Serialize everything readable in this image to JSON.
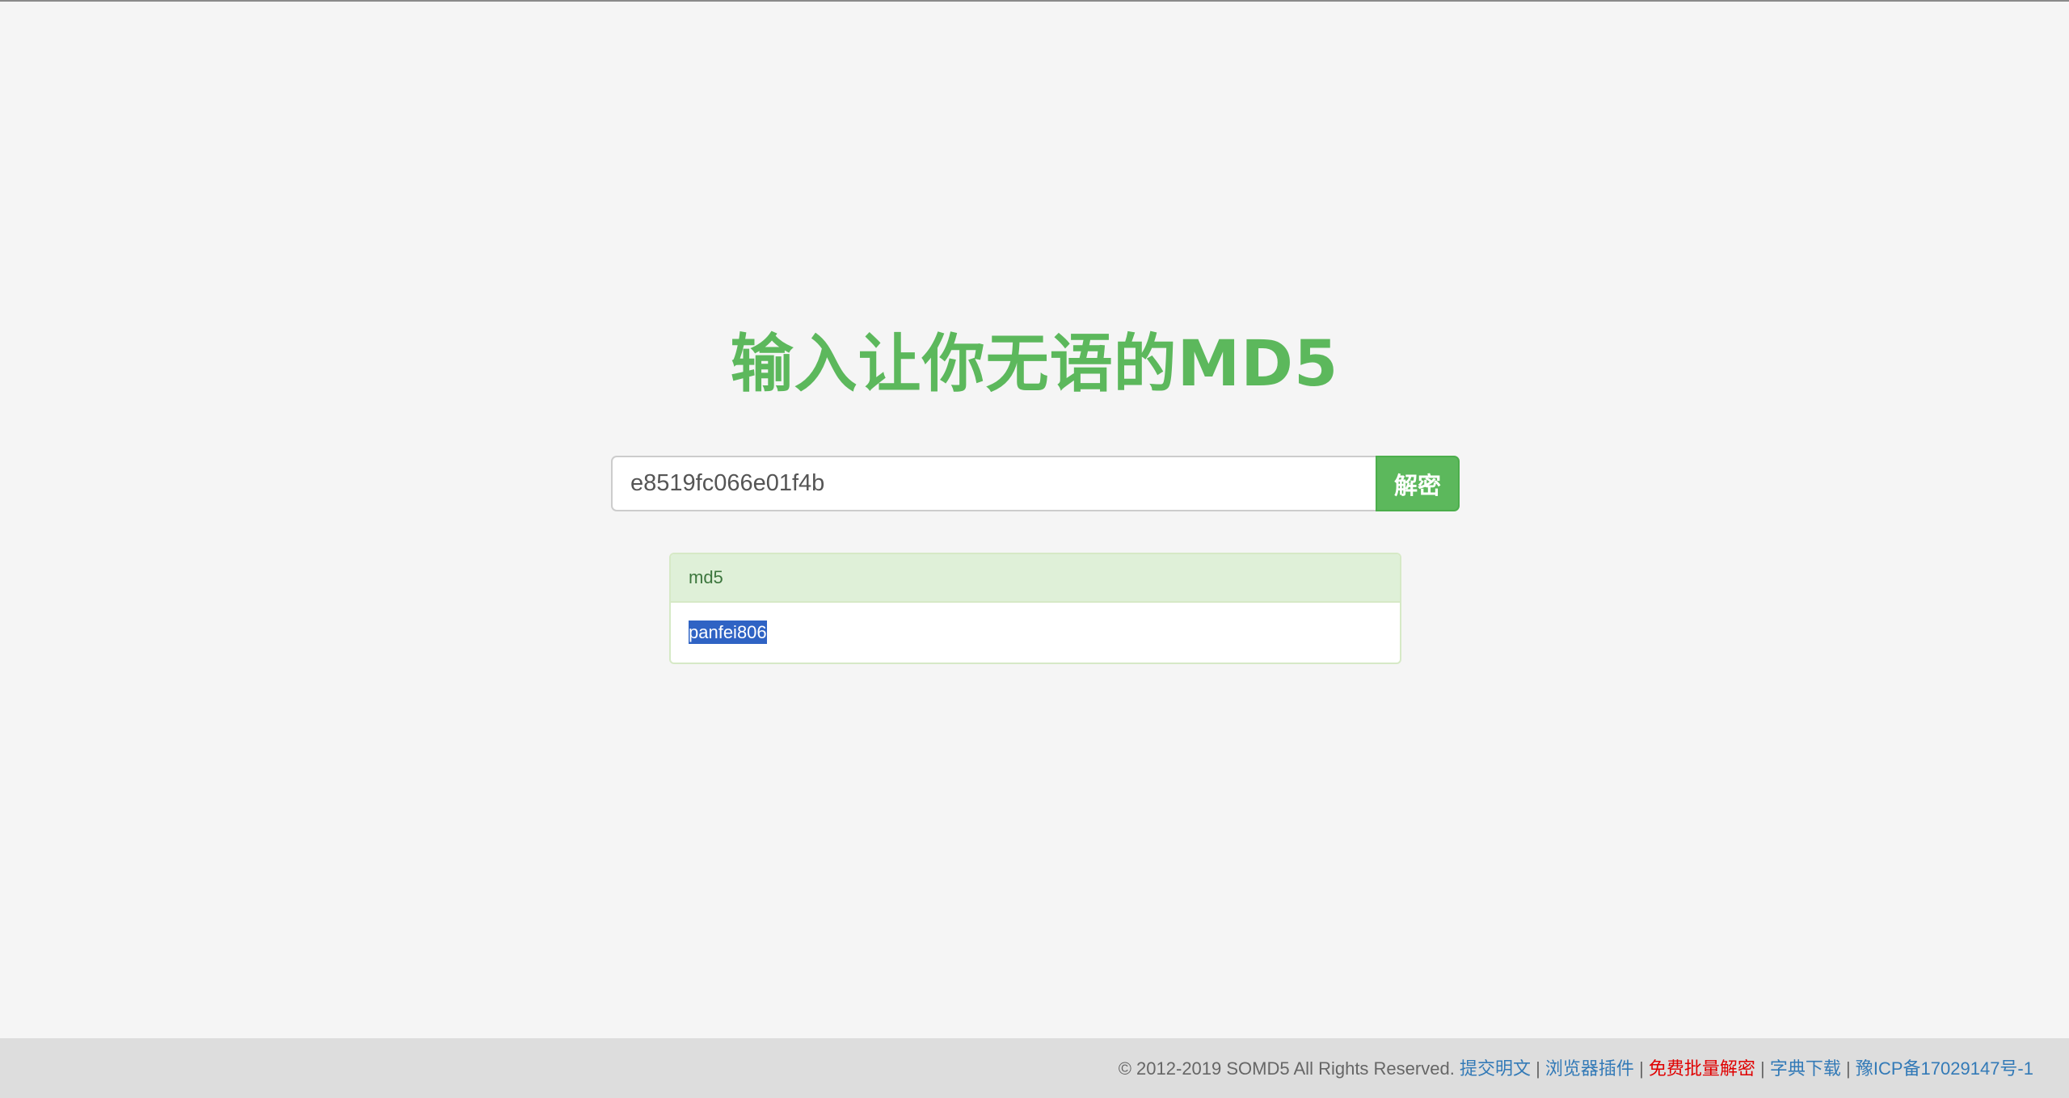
{
  "page": {
    "title": "输入让你无语的MD5"
  },
  "search": {
    "value": "e8519fc066e01f4b",
    "button_label": "解密"
  },
  "result": {
    "heading": "md5",
    "value": "panfei806"
  },
  "footer": {
    "copyright": "© 2012-2019 SOMD5 All Rights Reserved.",
    "separator": "|",
    "links": [
      {
        "label": "提交明文",
        "color": "#337ab7"
      },
      {
        "label": "浏览器插件",
        "color": "#337ab7"
      },
      {
        "label": "免费批量解密",
        "color": "#e00000"
      },
      {
        "label": "字典下载",
        "color": "#337ab7"
      },
      {
        "label": "豫ICP备17029147号-1",
        "color": "#337ab7"
      }
    ]
  },
  "colors": {
    "accent_green": "#5cb85c",
    "panel_heading_bg": "#dff0d8",
    "selection_blue": "#2f63c4",
    "link_blue": "#337ab7",
    "link_red": "#e00000"
  }
}
